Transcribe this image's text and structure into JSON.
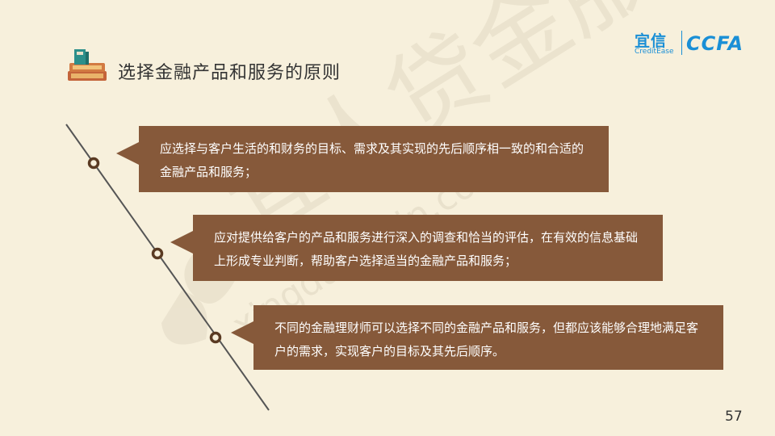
{
  "title": "选择金融产品和服务的原则",
  "logo": {
    "name_cn": "宜信",
    "name_en": "CreditEase",
    "partner": "CCFA"
  },
  "watermark": {
    "text_cn": "宜人贷金服",
    "text_en": "xingdai.yixin.com"
  },
  "principles": [
    {
      "text": "应选择与客户生活的和财务的目标、需求及其实现的先后顺序相一致的和合适的金融产品和服务；"
    },
    {
      "text": "应对提供给客户的产品和服务进行深入的调查和恰当的评估，在有效的信息基础上形成专业判断，帮助客户选择适当的金融产品和服务；"
    },
    {
      "text": "不同的金融理财师可以选择不同的金融产品和服务，但都应该能够合理地满足客户的需求，实现客户的目标及其先后顺序。"
    }
  ],
  "page_number": "57",
  "colors": {
    "background": "#f7f0dc",
    "box": "#86593a",
    "logo_blue": "#1a8fd6",
    "timeline": "#555555"
  }
}
